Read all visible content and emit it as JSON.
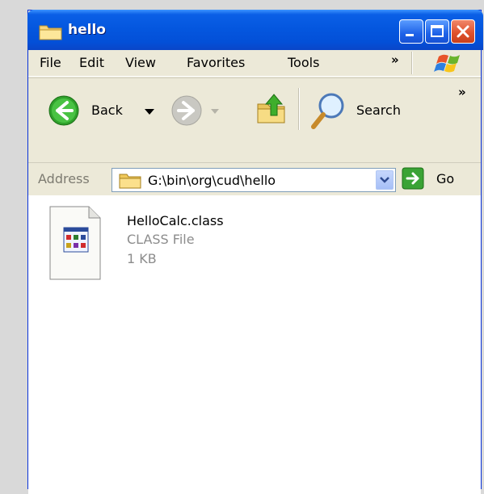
{
  "window": {
    "title": "hello"
  },
  "menu": {
    "items": [
      {
        "label": "File"
      },
      {
        "label": "Edit"
      },
      {
        "label": "View"
      },
      {
        "label": "Favorites"
      },
      {
        "label": "Tools"
      }
    ],
    "overflow": "»"
  },
  "toolbar": {
    "back_label": "Back",
    "search_label": "Search",
    "overflow": "»"
  },
  "address": {
    "label": "Address",
    "value": "G:\\bin\\org\\cud\\hello",
    "go_label": "Go"
  },
  "files": [
    {
      "name": "HelloCalc.class",
      "type": "CLASS File",
      "size": "1 KB"
    }
  ],
  "colors": {
    "titlebar": "#0456de",
    "chrome": "#ece9d8",
    "close_button": "#e0532e"
  }
}
